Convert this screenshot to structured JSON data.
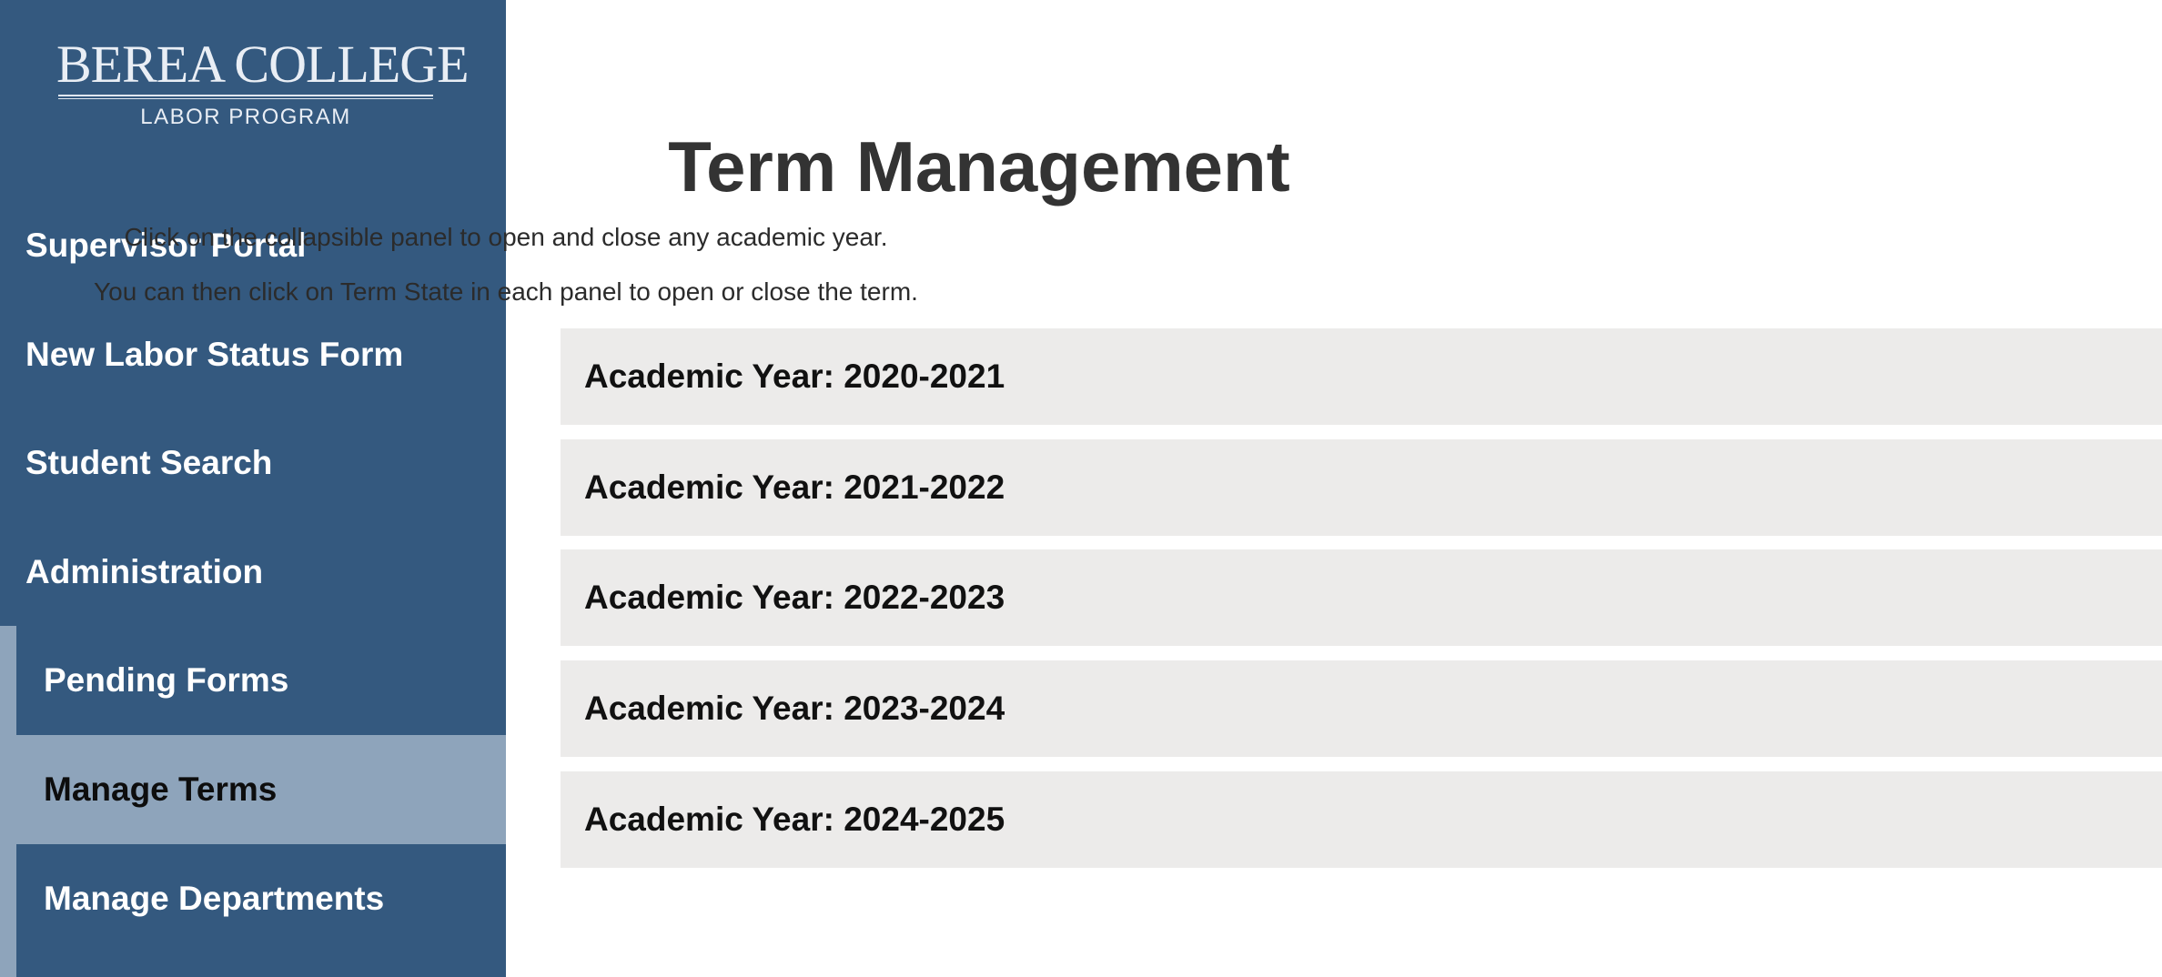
{
  "logo": {
    "line1": "BEREA COLLEGE",
    "line2": "LABOR PROGRAM"
  },
  "sidebar": {
    "items": [
      {
        "label": "Supervisor Portal"
      },
      {
        "label": "New Labor Status Form"
      },
      {
        "label": "Student Search"
      },
      {
        "label": "Administration"
      }
    ],
    "sub_items": [
      {
        "label": "Pending Forms"
      },
      {
        "label": "Manage Terms",
        "active": true
      },
      {
        "label": "Manage Departments"
      }
    ]
  },
  "main": {
    "title": "Term Management",
    "instructions": [
      "Click on the collapsible panel to open and close any academic year.",
      "You can then click on Term State in each panel to open or close the term."
    ],
    "panels": [
      {
        "label": "Academic Year: 2020-2021"
      },
      {
        "label": "Academic Year: 2021-2022"
      },
      {
        "label": "Academic Year: 2022-2023"
      },
      {
        "label": "Academic Year: 2023-2024"
      },
      {
        "label": "Academic Year: 2024-2025"
      }
    ]
  },
  "colors": {
    "sidebar_bg": "#34597f",
    "sidebar_active_bg": "#8ea4bb",
    "panel_bg": "#ecebea",
    "title_text": "#333333"
  }
}
